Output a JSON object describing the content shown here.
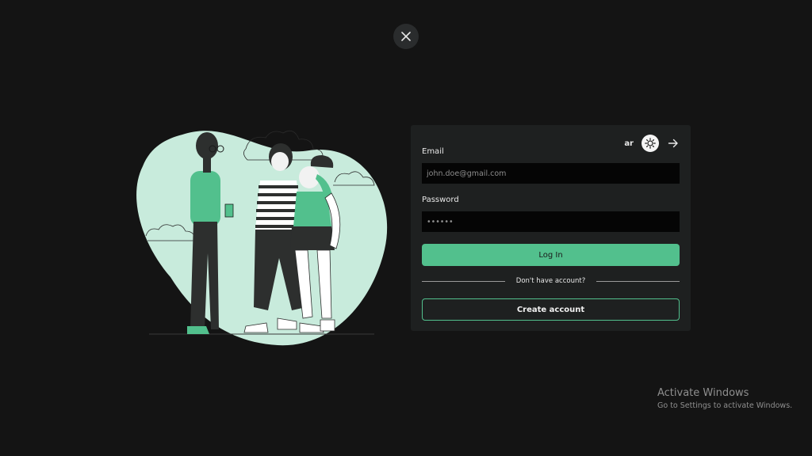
{
  "colors": {
    "background": "#141414",
    "card": "#1e2020",
    "accent": "#52c08d",
    "input": "#050505"
  },
  "close_button": {
    "icon": "close-icon"
  },
  "illustration": {
    "icon": "people-illustration"
  },
  "card": {
    "language": "ar",
    "theme_icon": "sun-icon",
    "continue_icon": "arrow-right-icon",
    "email_label": "Email",
    "email_placeholder": "john.doe@gmail.com",
    "password_label": "Password",
    "password_value": "••••••",
    "login_label": "Log In",
    "divider_text": "Don't have account?",
    "create_label": "Create account"
  },
  "watermark": {
    "title": "Activate Windows",
    "subtitle": "Go to Settings to activate Windows."
  }
}
